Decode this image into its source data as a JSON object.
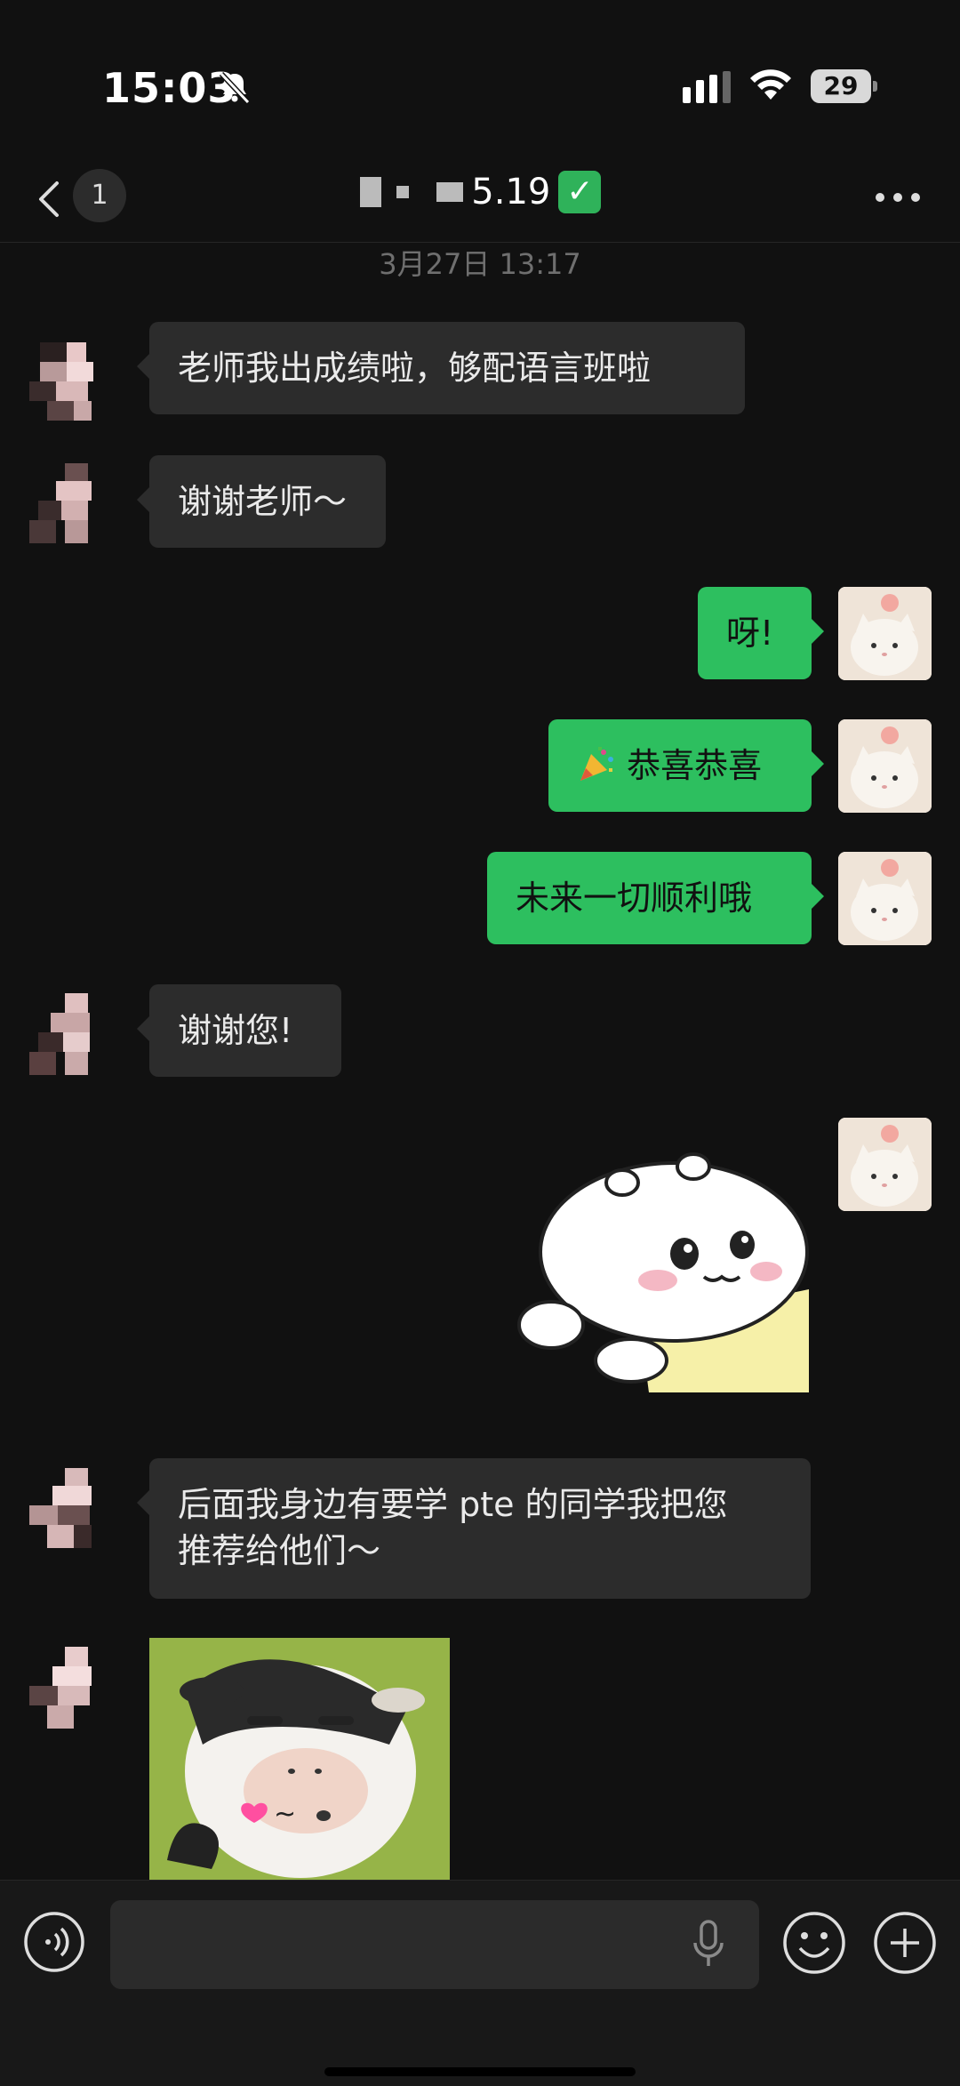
{
  "status_bar": {
    "time": "15:03",
    "battery_level": "29"
  },
  "nav": {
    "back_badge": "1",
    "title_visible": "5.19",
    "verified_emoji": "✓"
  },
  "timestamp": "3月27日 13:17",
  "messages": [
    {
      "side": "left",
      "type": "text",
      "text": "老师我出成绩啦，够配语言班啦"
    },
    {
      "side": "left",
      "type": "text",
      "text": "谢谢老师～"
    },
    {
      "side": "right",
      "type": "text",
      "text": "呀!"
    },
    {
      "side": "right",
      "type": "text",
      "text": "恭喜恭喜",
      "emoji": "party-popper"
    },
    {
      "side": "right",
      "type": "text",
      "text": "未来一切顺利哦"
    },
    {
      "side": "left",
      "type": "text",
      "text": "谢谢您!"
    },
    {
      "side": "right",
      "type": "sticker",
      "sticker": "white-hamster-sticker"
    },
    {
      "side": "left",
      "type": "text",
      "text_line1": "后面我身边有要学 pte 的同学我把您",
      "text_line2": "推荐给他们～"
    },
    {
      "side": "left",
      "type": "sticker",
      "sticker": "cow-meme-sticker",
      "caption": "~"
    }
  ],
  "colors": {
    "background": "#111111",
    "incoming_bubble": "#2c2c2c",
    "outgoing_bubble": "#2dbf5f"
  }
}
